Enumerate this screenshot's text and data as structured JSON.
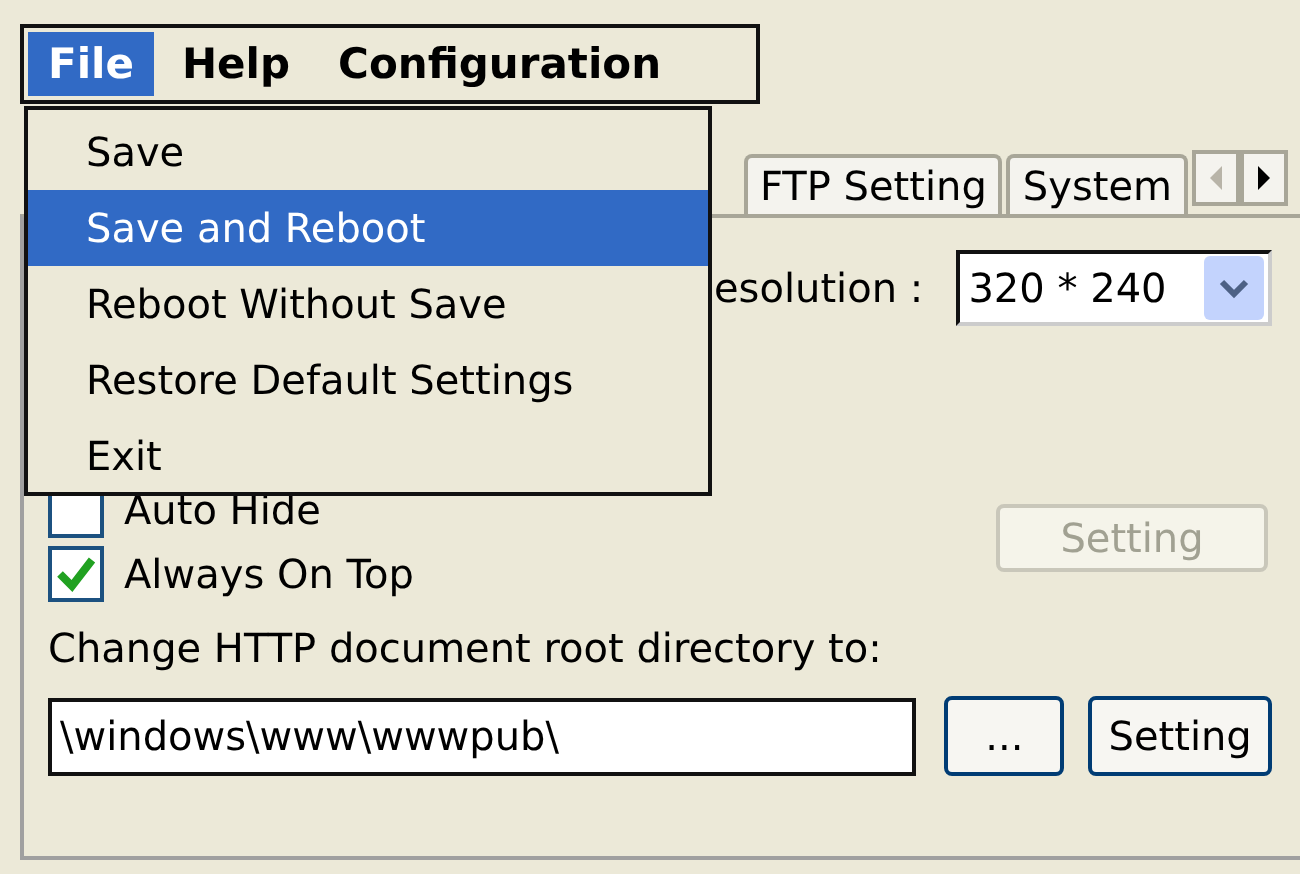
{
  "menubar": [
    {
      "label": "File",
      "selected": true
    },
    {
      "label": "Help",
      "selected": false
    },
    {
      "label": "Configuration",
      "selected": false
    }
  ],
  "file_menu": [
    {
      "label": "Save",
      "selected": false
    },
    {
      "label": "Save and Reboot",
      "selected": true
    },
    {
      "label": "Reboot Without Save",
      "selected": false
    },
    {
      "label": "Restore Default Settings",
      "selected": false
    },
    {
      "label": "Exit",
      "selected": false
    }
  ],
  "tabs": [
    {
      "label": "FTP Setting",
      "selected": false
    },
    {
      "label": "System",
      "selected": false
    }
  ],
  "resolution": {
    "label": "esolution :",
    "value": "320 * 240"
  },
  "checkboxes": [
    {
      "label": "Auto Hide",
      "checked": false
    },
    {
      "label": "Always On Top",
      "checked": true
    }
  ],
  "setting_button": {
    "label": "Setting",
    "disabled": true
  },
  "root_dir": {
    "label": "Change HTTP document root directory to:",
    "value": "\\windows\\www\\wwwpub\\",
    "browse_label": "...",
    "button": {
      "label": "Setting",
      "disabled": false
    }
  }
}
